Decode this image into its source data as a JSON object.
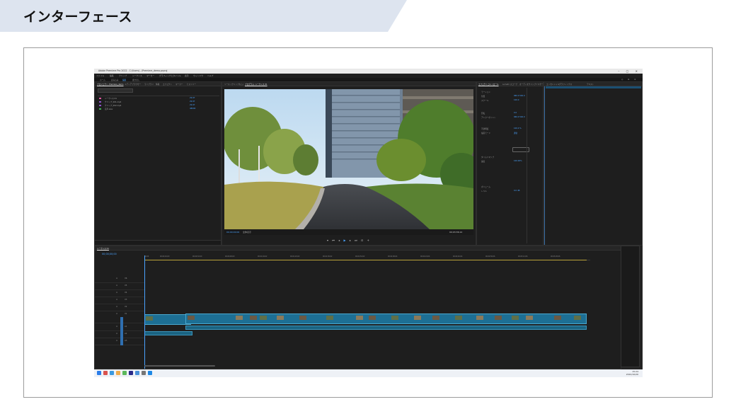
{
  "slide": {
    "title": "インターフェース"
  },
  "app": {
    "window_title": "Adobe Premiere Pro 2022 - C:\\Users\\...\\Premiere_demo.prproj",
    "menu": [
      "ファイル",
      "編集",
      "クリップ",
      "シーケンス",
      "マーカー",
      "グラフィックとタイトル",
      "表示",
      "ウィンドウ",
      "ヘルプ"
    ],
    "workspace_tabs": [
      "ホーム",
      "読み込み",
      "編集",
      "書き出し"
    ],
    "project_panel": {
      "tabs": [
        "プロジェクト: Premiere_demo",
        "メディアブラウザー",
        "ライブラリ",
        "情報",
        "エフェクト",
        "マーカー",
        "ヒストリー"
      ],
      "search_placeholder": "",
      "items": [
        {
          "name": "シーケンス 01",
          "color": "#e0569f"
        },
        {
          "name": "クリップ_001.mp4",
          "color": "#8d54c9"
        },
        {
          "name": "クリップ_002.mp4",
          "color": "#8d54c9"
        },
        {
          "name": "音声.wav",
          "color": "#3fae55"
        }
      ]
    },
    "program_monitor": {
      "tabs": [
        "ソース: (クリップなし)",
        "プログラム: シーケンス 01"
      ],
      "timecode_left": "00;00;00;00",
      "fit_label": "全体表示",
      "timecode_right": "00;03;36;12"
    },
    "effect_controls": {
      "tabs": [
        "エフェクトコントロール",
        "Lumetri スコープ",
        "オーディオクリップミキサー"
      ],
      "rows": [
        {
          "label": "モーション",
          "value": ""
        },
        {
          "label": "位置",
          "value": "960.0 540.0"
        },
        {
          "label": "スケール",
          "value": "100.0"
        },
        {
          "label": "回転",
          "value": "0.0"
        },
        {
          "label": "アンカーポイント",
          "value": "960.0 540.0"
        },
        {
          "label": "不透明度",
          "value": "100.0 %"
        },
        {
          "label": "描画モード",
          "value": "通常"
        },
        {
          "label": "タイムリマップ",
          "value": ""
        },
        {
          "label": "速度",
          "value": "100.00%"
        },
        {
          "label": "ボリューム",
          "value": ""
        },
        {
          "label": "レベル",
          "value": "0.0 dB"
        }
      ]
    },
    "essential_panel": {
      "tabs": [
        "エッセンシャルグラフィックス",
        "テキスト"
      ]
    },
    "timeline": {
      "tab": "シーケンス 01",
      "timecode": "00;00;00;00",
      "ruler": [
        "00;00",
        "00;00;16;00",
        "00;00;32;00",
        "00;00;48;00",
        "00;01;04;02",
        "00;01;20;02",
        "00;01;36;02",
        "00;01;52;02",
        "00;02;08;04",
        "00;02;24;04",
        "00;02;40;04",
        "00;02;56;06",
        "00;03;12;06",
        "00;03;28;06"
      ],
      "tracks": [
        "V6",
        "V5",
        "V4",
        "V3",
        "V2",
        "V1",
        "A1",
        "A2",
        "A3"
      ]
    },
    "taskbar": {
      "time": "15:24",
      "date": "2022/10/26"
    }
  }
}
